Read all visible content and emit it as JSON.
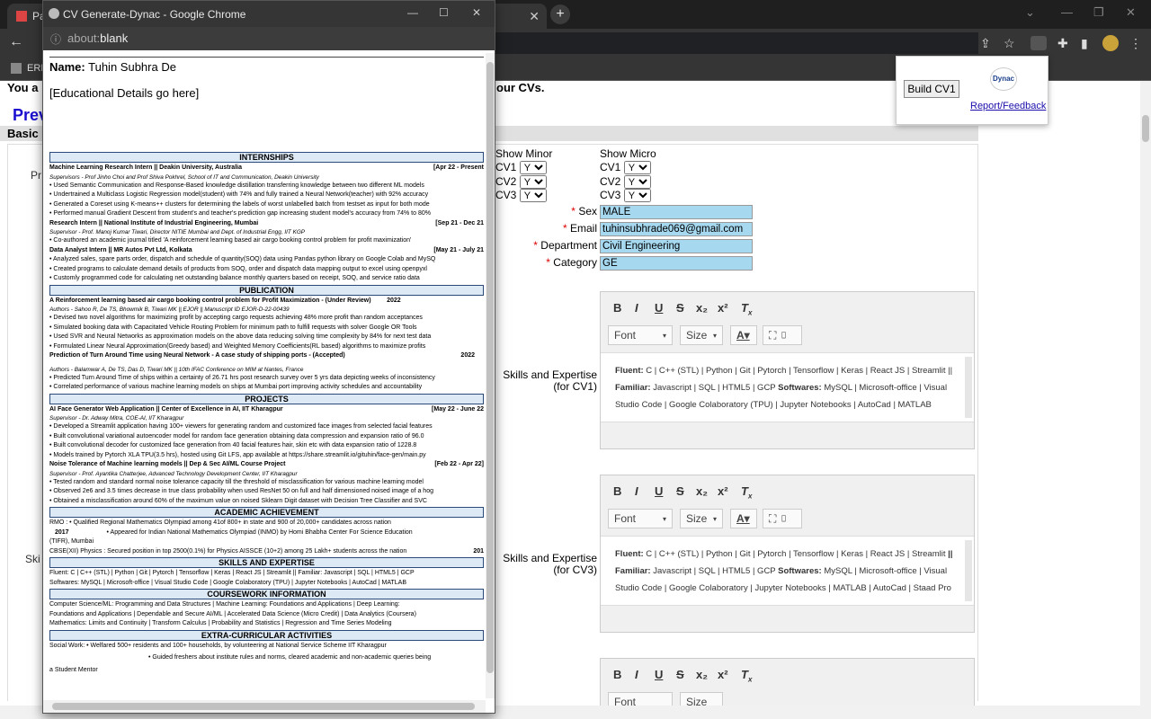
{
  "browser": {
    "tabs": [
      {
        "label": "Pa"
      },
      {
        "label": "CV Generate-Dynac - Google Chrome"
      }
    ],
    "new_tab": "+",
    "bookmark": "ERI"
  },
  "page": {
    "partial_left_1": "You a",
    "partial_right_1": "our CVs.",
    "partial_prev": "Prev",
    "partial_basic": "Basic",
    "partial_pr": "Pr",
    "partial_ski": "Ski",
    "show_minor": "Show Minor",
    "show_micro": "Show Micro",
    "cv_rows": [
      {
        "label": "CV1",
        "minor": "Y",
        "micro": "Y"
      },
      {
        "label": "CV2",
        "minor": "Y",
        "micro": "Y"
      },
      {
        "label": "CV3",
        "minor": "Y",
        "micro": "Y"
      }
    ],
    "fields": [
      {
        "label": "Sex",
        "value": "MALE"
      },
      {
        "label": "Email",
        "value": "tuhinsubhrade069@gmail.com"
      },
      {
        "label": "Department",
        "value": "Civil Engineering"
      },
      {
        "label": "Category",
        "value": "GE"
      }
    ],
    "req_mark": "*",
    "skills_cv1_label": "Skills and Expertise",
    "skills_cv1_sub": "(for CV1)",
    "skills_cv3_label": "Skills and Expertise",
    "skills_cv3_sub": "(for CV3)",
    "editor_font": "Font",
    "editor_size": "Size",
    "editor_cv1_html": "<b>Fluent:</b> C | C++ (STL) | Python | Git | Pytorch | Tensorflow | Keras | React JS | Streamlit || <b>Familiar:</b> Javascript | SQL | HTML5 | GCP <b>Softwares:</b> MySQL | Microsoft-office | Visual Studio Code | Google Colaboratory (TPU) | Jupyter Notebooks | AutoCad | MATLAB",
    "editor_cv3_html": "<b>Fluent:</b> C | C++ (STL) | Python | Git | Pytorch | Tensorflow | Keras | React JS | Streamlit <b>|| Familiar:</b> Javascript | SQL | HTML5 | GCP <b>Softwares:</b> MySQL | Microsoft-office | Visual Studio Code | Google Colaboratory | Jupyter Notebooks | MATLAB | AutoCad | Staad Pro"
  },
  "extension": {
    "button": "Build CV1",
    "logo_text": "Dynac",
    "link": "Report/Feedback"
  },
  "popup": {
    "title": "CV Generate-Dynac - Google Chrome",
    "address_host": "about:",
    "address_path": "blank",
    "name_label": "Name:",
    "name_value": "Tuhin Subhra De",
    "edu_placeholder": "[Educational Details go here]",
    "sections": {
      "internships": "INTERNSHIPS",
      "publication": "PUBLICATION",
      "projects": "PROJECTS",
      "academic": "ACADEMIC ACHIEVEMENT",
      "skills": "SKILLS AND EXPERTISE",
      "coursework": "COURSEWORK INFORMATION",
      "extra": "EXTRA-CURRICULAR ACTIVITIES"
    },
    "lines": {
      "i1": "Machine Learning Research Intern || Deakin University, Australia",
      "i1d": "[Apr 22 - Present",
      "i1s": "Supervisors - Prof Jinho Choi and Prof Shiva Pokhrel, School of IT and Communication, Deakin University",
      "i1b1": "• Used Semantic Communication and Response-Based knowledge distillation transferring knowledge between two different ML models",
      "i1b2": "• Undertrained a Multiclass Logistic Regression model(student) with 74% and fully trained a Neural Network(teacher) with 92% accuracy",
      "i1b3": "• Generated a Coreset using K-means++ clusters for determining the labels of worst unlabelled batch from testset as input for both mode",
      "i1b4": "• Performed manual Gradient Descent from student's and teacher's prediction gap increasing student model's accuracy from 74% to 80%",
      "i2": "Research Intern || National Institute of Industrial Engineering, Mumbai",
      "i2d": "[Sep 21 - Dec 21",
      "i2s": "Supervisor - Prof. Manoj Kumar Tiwari, Director NITIE Mumbai and Dept. of Industrial Engg, IIT KGP",
      "i2b1": "• Co-authored an academic journal titled 'A reinforcement learning based air cargo booking control problem for profit maximization'",
      "i3": "Data Analyst Intern || MR Autos Pvt Ltd, Kolkata",
      "i3d": "[May 21 - July 21",
      "i3b1": "• Analyzed sales, spare parts order, dispatch and schedule of quantity(SOQ) data using Pandas python library on Google Colab and MySQ",
      "i3b2": "• Created programs to calculate demand details of products from SOQ, order and dispatch data mapping output to excel using openpyxl",
      "i3b3": "• Customly programmed code for calculating net outstanding balance monthly quarters based on receipt, SOQ, and service ratio data",
      "p1": "A Reinforcement learning based air cargo booking control problem for Profit Maximization - (Under Review)",
      "p1y": "2022",
      "p1a": "Authors - Sahoo R, De TS, Bhowmik B, Tiwari MK || EJOR || Manuscript ID EJOR-D-22-00439",
      "p1b1": "• Devised two novel algorithms for maximizing profit by accepting cargo requests achieving 48% more profit than random acceptances",
      "p1b2": "• Simulated booking data with Capacitated Vehicle Routing Problem for minimum path to fulfill requests with solver Google OR Tools",
      "p1b3": "• Used SVR and Neural Networks as approximation models on the above data reducing solving time complexity by 84% for next test data",
      "p1b4": "• Formulated Linear Neural Approximation(Greedy based) and Weighted Memory Coefficients(RL based) algorithms to maximize profits",
      "p2": "Prediction of Turn Around Time using Neural Network - A case study of shipping ports - (Accepted)",
      "p2y": "2022",
      "p2a": "Authors - Balamwar A, De TS, Das D, Tiwari MK || 10th IFAC Conference on MIM at Nantes, France",
      "p2b1": "• Predicted Turn Around Time of ships within a certainty of 26.71 hrs post research survey over 5 yrs data depicting weeks of inconsistency",
      "p2b2": "• Correlated performance of various machine learning models on ships at Mumbai port improving activity schedules and accountability",
      "pr1": "AI Face Generator Web Application || Center of Excellence in AI, IIT Kharagpur",
      "pr1d": "[May 22 - June 22",
      "pr1s": "Supervisor - Dr. Adway Mitra, COE-AI, IIT Kharagpur",
      "pr1b1": "• Developed a Streamlit application having 100+ viewers for generating random and customized face images from selected facial features",
      "pr1b2": "• Built convolutional variational autoencoder model for random face generation obtaining data compression and expansion ratio of 96.0",
      "pr1b3": "• Built convolutional decoder for customized face generation from 40 facial features hair, skin etc with data expansion ratio of 1228.8",
      "pr1b4": "• Models trained by Pytorch XLA TPU(3.5 hrs), hosted using Git LFS, app available at https://share.streamlit.io/gituhin/face-gen/main.py",
      "pr2": "Noise Tolerance of Machine learning models || Dep & Sec AI/ML Course Project",
      "pr2d": "[Feb 22 - Apr 22]",
      "pr2s": "Supervisor - Prof. Ayantika Chatterjee, Advanced Technology Development Center, IIT Kharagpur",
      "pr2b1": "• Tested random and standard normal noise tolerance capacity till the threshold of misclassification for various machine learning model",
      "pr2b2": "• Observed 2e6 and 3.5 times decrease in true class probability when used ResNet 50 on full and half dimensioned noised image of a hog",
      "pr2b3": "• Obtained a misclassification around 60% of the maximum value on noised Sklearn Digit dataset with Decision Tree Classifier and SVC",
      "a1": "RMO : • Qualified Regional Mathematics Olympiad among 41of 800+ in state and 900 of 20,000+ candidates across nation",
      "a2y": "2017",
      "a2": "• Appeared for Indian National Mathematics Olympiad (INMO) by Homi Bhabha Center For Science Education",
      "a2b": "(TIFR), Mumbai",
      "a3": "CBSE(XII) Physics : Secured position in top 2500(0.1%) for Physics AISSCE (10+2) among 25 Lakh+ students across the nation",
      "a3y": "201",
      "s1": "Fluent: C | C++ (STL) | Python | Git | Pytorch | Tensorflow | Keras | React JS | Streamlit || Familiar: Javascript | SQL | HTML5 | GCP",
      "s2": "Softwares: MySQL | Microsoft-office | Visual Studio Code | Google Colaboratory (TPU) | Jupyter Notebooks | AutoCad | MATLAB",
      "c1": "Computer Science/ML: Programming and Data Structures | Machine Learning: Foundations and Applications | Deep Learning:",
      "c2": "Foundations and Applications | Dependable and Secure AI/ML | Accelerated Data Science (Micro Credit) | Data Analytics (Coursera)",
      "c3": "Mathematics: Limits and Continuity | Transform Calculus | Probability and Statistics | Regression and Time Series Modeling",
      "e1": "Social Work: • Welfared 500+ residents and 100+ households, by volunteering at National Service Scheme IIT Kharagpur",
      "e2": "• Guided freshers about institute rules and norms, cleared academic and non-academic queries being",
      "e3": "a Student Mentor"
    }
  },
  "colors": {
    "chrome_dark": "#1f1f1f",
    "input_fill": "#a6d8f0",
    "section_fill": "#dde9f4",
    "link": "#1a0dab"
  }
}
